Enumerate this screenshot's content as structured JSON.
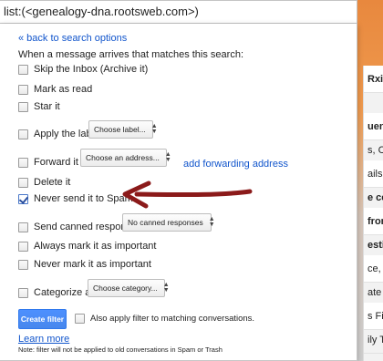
{
  "search": {
    "query": "list:(<genealogy-dna.rootsweb.com>)"
  },
  "panel": {
    "back_link": "« back to search options",
    "intro": "When a message arrives that matches this search:",
    "options": {
      "skip_inbox": "Skip the Inbox (Archive it)",
      "mark_read": "Mark as read",
      "star": "Star it",
      "apply_label": "Apply the label:",
      "forward": "Forward it to:",
      "delete": "Delete it",
      "never_spam": "Never send it to Spam",
      "canned": "Send canned response:",
      "always_important": "Always mark it as important",
      "never_important": "Never mark it as important",
      "categorize": "Categorize as:"
    },
    "dropdowns": {
      "label": "Choose label...",
      "address": "Choose an address...",
      "canned": "No canned responses",
      "category": "Choose category..."
    },
    "add_forwarding": "add forwarding address",
    "create_button": "Create filter",
    "also_apply": "Also apply filter to matching conversations.",
    "learn_more": "Learn more",
    "note": "Note: filter will not be applied to old conversations in Spam or Trash"
  },
  "checked": {
    "never_spam": true
  },
  "background_rows": [
    {
      "text": "Rxiv",
      "bold": true
    },
    {
      "text": "",
      "bold": false
    },
    {
      "text": "uenc",
      "bold": true
    },
    {
      "text": "s, C",
      "bold": false
    },
    {
      "text": "ails",
      "bold": false
    },
    {
      "text": "e ce",
      "bold": true
    },
    {
      "text": "from",
      "bold": true
    },
    {
      "text": "esti",
      "bold": true
    },
    {
      "text": "ce, -",
      "bold": false
    },
    {
      "text": "ate i",
      "bold": false
    },
    {
      "text": "s Fir",
      "bold": false
    },
    {
      "text": "ily T",
      "bold": false
    }
  ],
  "annotation_color": "#8b1a1a"
}
